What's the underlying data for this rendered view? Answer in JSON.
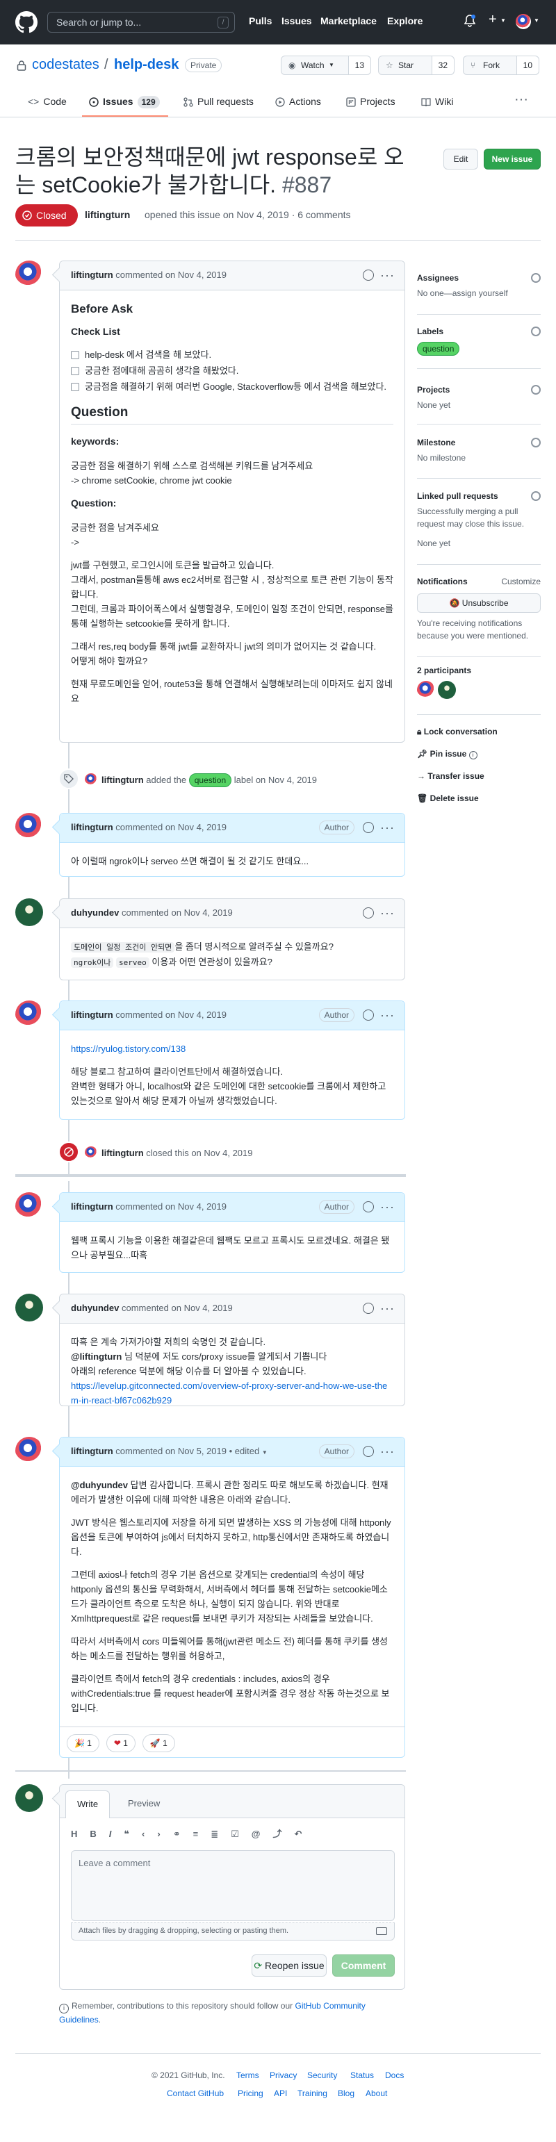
{
  "header": {
    "search_placeholder": "Search or jump to...",
    "search_key": "/",
    "nav": [
      "Pulls",
      "Issues",
      "Marketplace",
      "Explore"
    ]
  },
  "repo": {
    "owner": "codestates",
    "separator": "/",
    "name": "help-desk",
    "visibility": "Private",
    "watch_label": "Watch",
    "watch_count": "13",
    "star_label": "Star",
    "star_count": "32",
    "fork_label": "Fork",
    "fork_count": "10",
    "tabs": [
      {
        "label": "Code"
      },
      {
        "label": "Issues",
        "count": "129"
      },
      {
        "label": "Pull requests"
      },
      {
        "label": "Actions"
      },
      {
        "label": "Projects"
      },
      {
        "label": "Wiki"
      }
    ],
    "more": "···"
  },
  "issue": {
    "title": "크롬의 보안정책때문에 jwt response로 오는 setCookie가 불가합니다.",
    "number": "#887",
    "edit_label": "Edit",
    "new_issue_label": "New issue",
    "state": "Closed",
    "author": "liftingturn",
    "meta": "opened this issue on Nov 4, 2019 · 6 comments"
  },
  "comments": {
    "c1": {
      "author": "liftingturn",
      "action": "commented on Nov 4, 2019",
      "h_before": "Before Ask",
      "h_checklist": "Check List",
      "check1": "help-desk 에서 검색을 해 보았다.",
      "check2": "궁금한 점에대해 곰곰히 생각을 해봤었다.",
      "check3": "궁금점을 해결하기 위해 여러번 Google, Stackoverflow등 에서 검색을 해보았다.",
      "h_question": "Question",
      "keywords_label": "keywords:",
      "kw1": "궁금한 점을 해결하기 위해 스스로 검색해본 키워드를 남겨주세요",
      "kw2": "-> chrome setCookie, chrome jwt cookie",
      "question_label": "Question:",
      "q1": "궁금한 점을 남겨주세요",
      "q2": "->",
      "p1": "jwt를 구현했고, 로그인시에 토큰을 발급하고 있습니다.",
      "p2": "그래서, postman들통해 aws ec2서버로 접근할 시 , 정상적으로 토큰 관련 기능이 동작합니다.",
      "p3": "그런데, 크롬과 파이어폭스에서 실행할경우, 도메인이 일정 조건이 안되면, response를 통해 실행하는 setcookie를 못하게 합니다.",
      "p4": "그래서 res,req body를 통해 jwt를 교환하자니 jwt의 의미가 없어지는 것 같습니다.",
      "p5": "어떻게 해야 할까요?",
      "p6": "현재 무료도메인을 얻어, route53을 통해 연결해서 실행해보려는데 이마저도 쉽지 않네요"
    },
    "event_label": {
      "actor": "liftingturn",
      "pre": "added the",
      "label": "question",
      "post": "label on Nov 4, 2019"
    },
    "c2": {
      "author": "liftingturn",
      "action": "commented on Nov 4, 2019",
      "badge": "Author",
      "text": "아 이럴때 ngrok이나 serveo 쓰면 해결이 될 것 같기도 한데요..."
    },
    "c3": {
      "author": "duhyundev",
      "action": "commented on Nov 4, 2019",
      "line1": "도메인이 일정 조건이 안되면",
      "line1b": "을 좀더 명시적으로 알려주실 수 있을까요?",
      "code1": "ngrok이나",
      "code2": "serveo",
      "line2b": "이용과 어떤 연관성이 있을까요?"
    },
    "c4": {
      "author": "liftingturn",
      "action": "commented on Nov 4, 2019",
      "badge": "Author",
      "link": "https://ryulog.tistory.com/138",
      "p1": "해당 블로그 참고하여 클라이언트단에서 해결하였습니다.",
      "p2": "완벽한 형태가 아니, localhost와 같은 도메인에 대한 setcookie를 크롬에서 제한하고 있는것으로 알아서 해당 문제가 아닐까 생각했었습니다."
    },
    "event_closed": {
      "actor": "liftingturn",
      "text": "closed this on Nov 4, 2019"
    },
    "c5": {
      "author": "liftingturn",
      "action": "commented on Nov 4, 2019",
      "badge": "Author",
      "text": "웹팩 프록시 기능을 이용한 해결같은데 웹팩도 모르고 프록시도 모르겠네요. 해결은 됐으나 공부필요...따흑"
    },
    "c6": {
      "author": "duhyundev",
      "action": "commented on Nov 4, 2019",
      "l1": "따흑 은 계속 가져가야할 저희의 숙명인 것 같습니다.",
      "mention": "@liftingturn",
      "l2": " 님 덕분에 저도 cors/proxy issue를 알게되서 기쁩니다",
      "l3": "아래의 reference 덕분에 해당 이슈를 더 알아볼 수 있었습니다.",
      "link": "https://levelup.gitconnected.com/overview-of-proxy-server-and-how-we-use-them-in-react-bf67c062b929"
    },
    "c7": {
      "author": "liftingturn",
      "action": "commented on Nov 5, 2019",
      "edited": "• edited",
      "badge": "Author",
      "mention": "@duhyundev",
      "p1": " 답변 감사합니다. 프록시 관한 정리도 따로 해보도록 하겠습니다. 현재 에러가 발생한 이유에 대해 파악한 내용은 아래와 같습니다.",
      "p2": "JWT 방식은 웹스토리지에 저장을 하게 되면 발생하는 XSS 의 가능성에 대해 httponly 옵션을 토큰에 부여하여 js에서 터치하지 못하고, http통신에서만 존재하도록 하였습니다.",
      "p3": "그런데 axios나 fetch의 경우 기본 옵션으로 갖게되는 credential의 속성이 해당 httponly 옵션의 통신을 무력화해서, 서버측에서 헤더를 통해 전달하는 setcookie메소드가 클라이언트 측으로 도착은 하나, 실행이 되지 않습니다. 위와 반대로 Xmlhttprequest로 같은 request를 보내면 쿠키가 저장되는 사례들을 보았습니다.",
      "p4": "따라서 서버측에서 cors 미들웨어를 통해(jwt관련 메소드 전) 헤더를 통해 쿠키를 생성하는 메소드를 전달하는 행위를 허용하고,",
      "p5": "클라이언트 측에서 fetch의 경우 credentials : includes, axios의 경우 withCredentials:true 를 request header에 포함시켜줄 경우 정상 작동 하는것으로 보입니다.",
      "reactions": [
        {
          "emoji": "🎉",
          "count": "1"
        },
        {
          "emoji": "❤",
          "count": "1"
        },
        {
          "emoji": "🚀",
          "count": "1"
        }
      ]
    }
  },
  "sidebar": {
    "assignees_h": "Assignees",
    "assignees_v": "No one—assign yourself",
    "labels_h": "Labels",
    "labels_v": "question",
    "projects_h": "Projects",
    "projects_v": "None yet",
    "milestone_h": "Milestone",
    "milestone_v": "No milestone",
    "linked_h": "Linked pull requests",
    "linked_d": "Successfully merging a pull request may close this issue.",
    "linked_v": "None yet",
    "notif_h": "Notifications",
    "notif_customize": "Customize",
    "unsubscribe": "Unsubscribe",
    "notif_d": "You're receiving notifications because you were mentioned.",
    "participants": "2 participants",
    "lock": "Lock conversation",
    "pin": "Pin issue",
    "transfer": "Transfer issue",
    "delete": "Delete issue"
  },
  "composer": {
    "write_tab": "Write",
    "preview_tab": "Preview",
    "placeholder": "Leave a comment",
    "attach": "Attach files by dragging & dropping, selecting or pasting them.",
    "reopen": "Reopen issue",
    "comment": "Comment",
    "note_pre": "Remember, contributions to this repository should follow our ",
    "note_link": "GitHub Community Guidelines",
    "note_post": "."
  },
  "footer": {
    "copyright": "© 2021 GitHub, Inc.",
    "row1": [
      "Terms",
      "Privacy",
      "Security",
      "Status",
      "Docs"
    ],
    "row2": [
      "Contact GitHub",
      "Pricing",
      "API",
      "Training",
      "Blog",
      "About"
    ]
  },
  "colors": {
    "header_bg": "#24292f",
    "closed_red": "#cf222e",
    "green": "#2da44e",
    "label_green": "#56d364",
    "link_blue": "#0969da"
  }
}
